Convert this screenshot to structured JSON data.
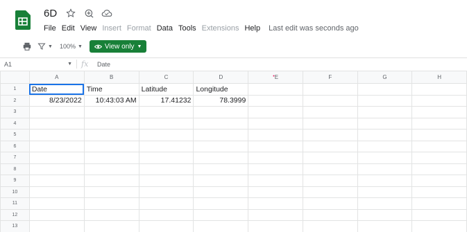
{
  "doc": {
    "title": "6D"
  },
  "menu": {
    "items": [
      {
        "label": "File",
        "enabled": true
      },
      {
        "label": "Edit",
        "enabled": true
      },
      {
        "label": "View",
        "enabled": true
      },
      {
        "label": "Insert",
        "enabled": false
      },
      {
        "label": "Format",
        "enabled": false
      },
      {
        "label": "Data",
        "enabled": true
      },
      {
        "label": "Tools",
        "enabled": true
      },
      {
        "label": "Extensions",
        "enabled": false
      },
      {
        "label": "Help",
        "enabled": true
      }
    ],
    "last_edit": "Last edit was seconds ago"
  },
  "toolbar": {
    "zoom": "100%",
    "view_only_label": "View only"
  },
  "formula_bar": {
    "cell_ref": "A1",
    "value": "Date"
  },
  "sheet": {
    "columns": [
      "A",
      "B",
      "C",
      "D",
      "E",
      "F",
      "G",
      "H"
    ],
    "row_numbers": [
      "1",
      "2",
      "3",
      "4",
      "5",
      "6",
      "7",
      "8",
      "9",
      "10",
      "11",
      "12",
      "13"
    ],
    "rows": [
      [
        "Date",
        "Time",
        "Latitude",
        "Longitude",
        "",
        "",
        "",
        ""
      ],
      [
        "8/23/2022",
        "10:43:03 AM",
        "17.41232",
        "78.3999",
        "",
        "",
        "",
        ""
      ]
    ],
    "numeric_row_index": 1
  },
  "colors": {
    "brand_green": "#188038",
    "selection_blue": "#1a73e8",
    "header_bg": "#f8f9fa"
  },
  "icons": {
    "logo": "sheets-logo-icon",
    "star": "star-icon",
    "move": "move-to-folder-icon",
    "cloud": "cloud-status-icon",
    "print": "print-icon",
    "filter": "filter-icon",
    "eye": "eye-icon"
  }
}
